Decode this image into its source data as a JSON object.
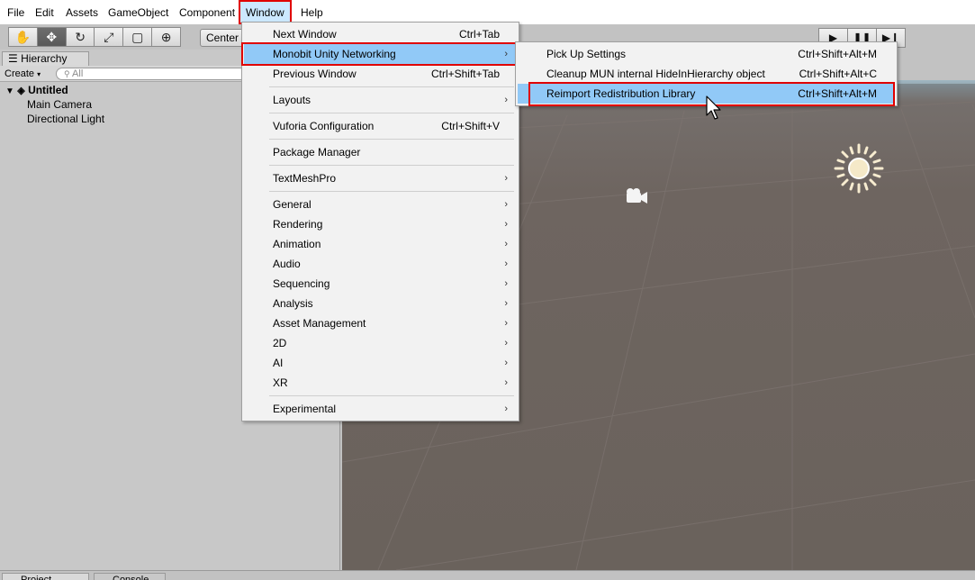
{
  "menubar": {
    "items": [
      "File",
      "Edit",
      "Assets",
      "GameObject",
      "Component",
      "Window",
      "Help"
    ]
  },
  "toolbar": {
    "tools": [
      "hand-tool",
      "move-tool",
      "rotate-tool",
      "scale-tool",
      "rect-tool",
      "transform-tool"
    ],
    "pivot_label": "Center",
    "play_buttons": [
      "play",
      "pause",
      "step"
    ]
  },
  "hierarchy": {
    "tab_label": "Hierarchy",
    "create_label": "Create",
    "search_placeholder": "All",
    "scene_name": "Untitled",
    "objects": [
      "Main Camera",
      "Directional Light"
    ]
  },
  "bottom_tabs": [
    "Project",
    "Console"
  ],
  "window_menu": {
    "items": [
      {
        "label": "Next Window",
        "shortcut": "Ctrl+Tab"
      },
      {
        "label": "Monobit Unity Networking",
        "submenu": true,
        "highlighted": true
      },
      {
        "label": "Previous Window",
        "shortcut": "Ctrl+Shift+Tab"
      },
      {
        "label": "Layouts",
        "submenu": true
      },
      {
        "label": "Vuforia Configuration",
        "shortcut": "Ctrl+Shift+V"
      },
      {
        "label": "Package Manager"
      },
      {
        "label": "TextMeshPro",
        "submenu": true
      },
      {
        "label": "General",
        "submenu": true
      },
      {
        "label": "Rendering",
        "submenu": true
      },
      {
        "label": "Animation",
        "submenu": true
      },
      {
        "label": "Audio",
        "submenu": true
      },
      {
        "label": "Sequencing",
        "submenu": true
      },
      {
        "label": "Analysis",
        "submenu": true
      },
      {
        "label": "Asset Management",
        "submenu": true
      },
      {
        "label": "2D",
        "submenu": true
      },
      {
        "label": "AI",
        "submenu": true
      },
      {
        "label": "XR",
        "submenu": true
      },
      {
        "label": "Experimental",
        "submenu": true
      }
    ]
  },
  "monobit_submenu": {
    "items": [
      {
        "label": "Pick Up Settings",
        "shortcut": "Ctrl+Shift+Alt+M"
      },
      {
        "label": "Cleanup MUN internal HideInHierarchy object",
        "shortcut": "Ctrl+Shift+Alt+C"
      },
      {
        "label": "Reimport Redistribution Library",
        "shortcut": "Ctrl+Shift+Alt+M",
        "highlighted": true
      }
    ]
  },
  "colors": {
    "highlight": "#91c9f7",
    "annotation_red": "#e00000",
    "menu_bg": "#f2f2f2",
    "scene_bg": "#6a625c"
  }
}
